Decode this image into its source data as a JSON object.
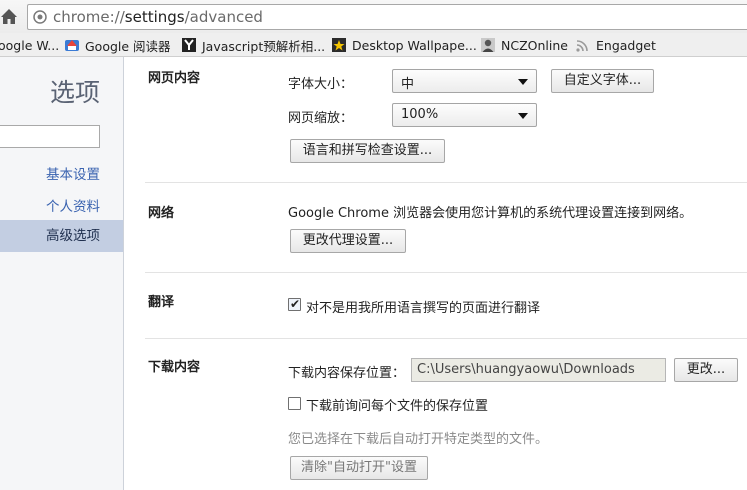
{
  "omnibox": {
    "url_scheme": "chrome://",
    "url_host": "settings",
    "url_path": "/advanced"
  },
  "bookmarks": [
    {
      "label": "oogle W...",
      "icon": "google-icon"
    },
    {
      "label": "Google 阅读器",
      "icon": "google-reader-icon"
    },
    {
      "label": "Javascript预解析相...",
      "icon": "y-icon"
    },
    {
      "label": "Desktop Wallpape...",
      "icon": "star-icon"
    },
    {
      "label": "NCZOnline",
      "icon": "avatar-icon"
    },
    {
      "label": "Engadget",
      "icon": "rss-icon"
    }
  ],
  "sidebar": {
    "title": "选项",
    "search_placeholder": "",
    "items": [
      {
        "label": "基本设置",
        "selected": false
      },
      {
        "label": "个人资料",
        "selected": false
      },
      {
        "label": "高级选项",
        "selected": true
      }
    ]
  },
  "sections": {
    "web_content": {
      "title": "网页内容",
      "font_size_label": "字体大小：",
      "font_size_value": "中",
      "custom_fonts_button": "自定义字体...",
      "zoom_label": "网页缩放：",
      "zoom_value": "100%",
      "language_button": "语言和拼写检查设置..."
    },
    "network": {
      "title": "网络",
      "description": "Google Chrome 浏览器会使用您计算机的系统代理设置连接到网络。",
      "proxy_button": "更改代理设置..."
    },
    "translate": {
      "title": "翻译",
      "checkbox_label": "对不是用我所用语言撰写的页面进行翻译",
      "checked": true
    },
    "downloads": {
      "title": "下载内容",
      "location_label": "下载内容保存位置：",
      "location_value": "C:\\Users\\huangyaowu\\Downloads",
      "change_button": "更改...",
      "ask_checkbox_label": "下载前询问每个文件的保存位置",
      "ask_checked": false,
      "auto_open_note": "您已选择在下载后自动打开特定类型的文件。",
      "clear_button": "清除\"自动打开\"设置"
    }
  },
  "colors": {
    "sidebar_bg": "#f5f6f8",
    "sidebar_selected": "#c3cee2",
    "link": "#3a63b0"
  }
}
